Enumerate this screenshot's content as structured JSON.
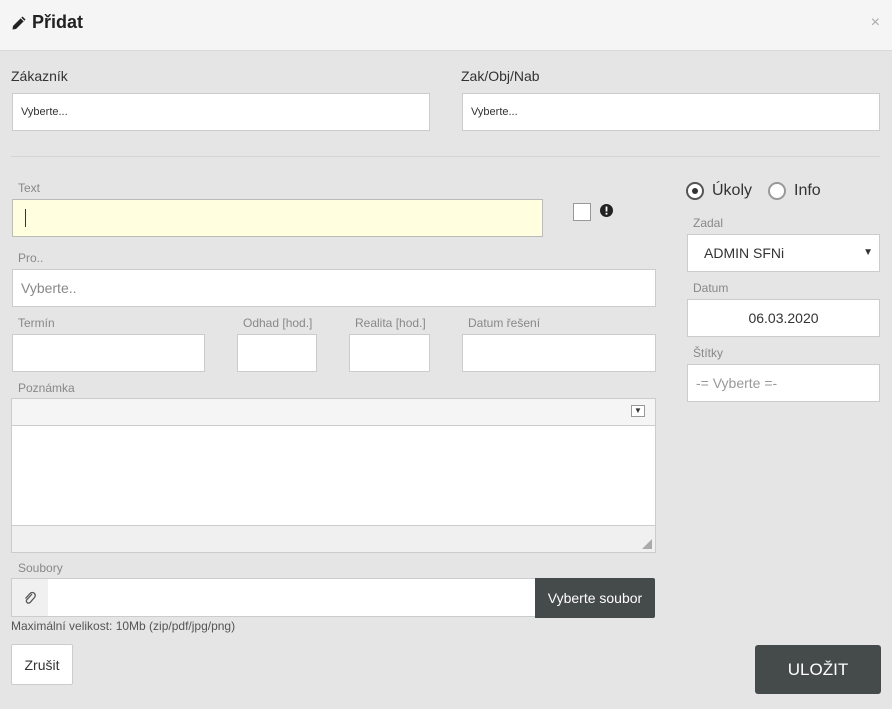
{
  "header": {
    "title": "Přidat",
    "close": "×"
  },
  "customer": {
    "label": "Zákazník",
    "placeholder": "Vyberte..."
  },
  "order": {
    "label": "Zak/Obj/Nab",
    "placeholder": "Vyberte..."
  },
  "text_field": {
    "label": "Text",
    "value": ""
  },
  "for_field": {
    "label": "Pro..",
    "placeholder": "Vyberte.."
  },
  "deadline": {
    "label": "Termín"
  },
  "estimate": {
    "label": "Odhad [hod.]"
  },
  "reality": {
    "label": "Realita [hod.]"
  },
  "solution_date": {
    "label": "Datum řešení"
  },
  "note": {
    "label": "Poznámka"
  },
  "files": {
    "label": "Soubory",
    "button": "Vyberte soubor",
    "hint": "Maximální velikost: 10Mb (zip/pdf/jpg/png)"
  },
  "type_radio": {
    "tasks": "Úkoly",
    "info": "Info",
    "selected": "tasks"
  },
  "assigned_by": {
    "label": "Zadal",
    "value": "ADMIN SFNi"
  },
  "date": {
    "label": "Datum",
    "value": "06.03.2020"
  },
  "tags": {
    "label": "Štítky",
    "placeholder": "-= Vyberte =-"
  },
  "actions": {
    "cancel": "Zrušit",
    "save": "ULOŽIT"
  }
}
